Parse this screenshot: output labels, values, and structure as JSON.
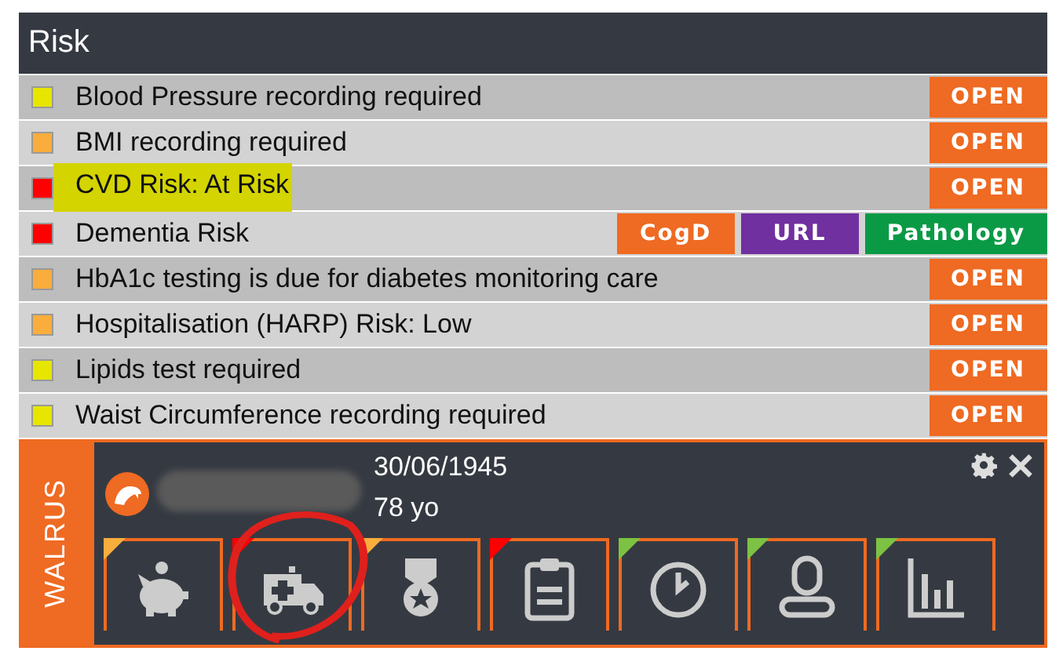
{
  "panel": {
    "title": "Risk"
  },
  "risks": [
    {
      "label": "Blood Pressure recording required",
      "color": "#e6e600",
      "highlighted": false,
      "actions": [
        {
          "label": "OPEN",
          "color": "#ef6a22"
        }
      ]
    },
    {
      "label": "BMI recording required",
      "color": "#f9ad3c",
      "highlighted": false,
      "actions": [
        {
          "label": "OPEN",
          "color": "#ef6a22"
        }
      ]
    },
    {
      "label": "CVD Risk: At Risk",
      "color": "#ff0000",
      "highlighted": true,
      "actions": [
        {
          "label": "OPEN",
          "color": "#ef6a22"
        }
      ]
    },
    {
      "label": "Dementia Risk",
      "color": "#ff0000",
      "highlighted": false,
      "actions": [
        {
          "label": "CogD",
          "color": "#ef6a22"
        },
        {
          "label": "URL",
          "color": "#7030a0"
        },
        {
          "label": "Pathology",
          "color": "#0a9a46"
        }
      ]
    },
    {
      "label": "HbA1c testing is due for diabetes monitoring care",
      "color": "#f9ad3c",
      "highlighted": false,
      "actions": [
        {
          "label": "OPEN",
          "color": "#ef6a22"
        }
      ]
    },
    {
      "label": "Hospitalisation (HARP) Risk: Low",
      "color": "#f9ad3c",
      "highlighted": false,
      "actions": [
        {
          "label": "OPEN",
          "color": "#ef6a22"
        }
      ]
    },
    {
      "label": "Lipids test required",
      "color": "#e6e600",
      "highlighted": false,
      "actions": [
        {
          "label": "OPEN",
          "color": "#ef6a22"
        }
      ]
    },
    {
      "label": "Waist Circumference recording required",
      "color": "#e6e600",
      "highlighted": false,
      "actions": [
        {
          "label": "OPEN",
          "color": "#ef6a22"
        }
      ]
    }
  ],
  "widget": {
    "brand": "WALRUS",
    "dob": "30/06/1945",
    "age": "78 yo",
    "tiles": [
      {
        "kind": "piggy",
        "color": "#f9ad3c"
      },
      {
        "kind": "ambulance",
        "color": "#ff0000"
      },
      {
        "kind": "medal",
        "color": "#f9ad3c"
      },
      {
        "kind": "clipboard",
        "color": "#ff0000"
      },
      {
        "kind": "clock",
        "color": "#7dc242"
      },
      {
        "kind": "person",
        "color": "#7dc242"
      },
      {
        "kind": "chart",
        "color": "#7dc242"
      }
    ]
  }
}
